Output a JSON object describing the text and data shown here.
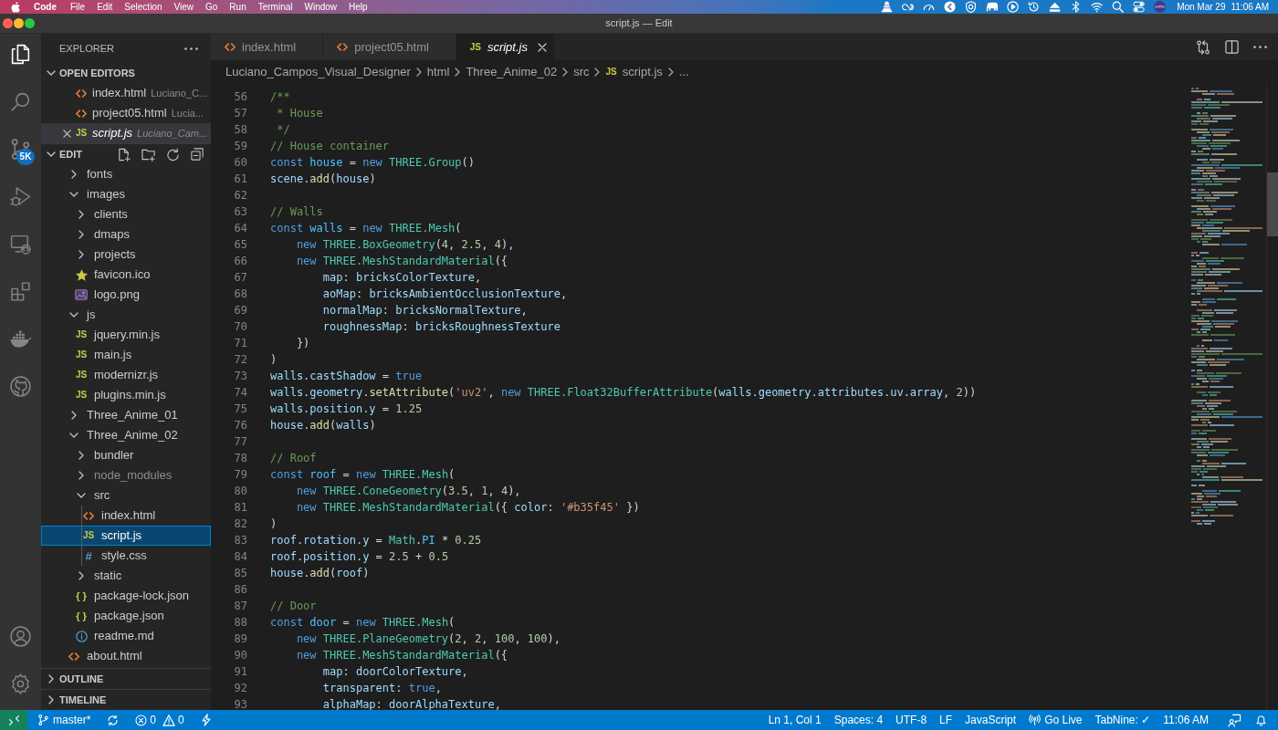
{
  "menu_bar": {
    "app": "Code",
    "menus": [
      "File",
      "Edit",
      "Selection",
      "View",
      "Go",
      "Run",
      "Terminal",
      "Window",
      "Help"
    ],
    "date": "Mon Mar 29",
    "time": "11:06 AM"
  },
  "window": {
    "title": "script.js — Edit"
  },
  "activity_bar": {
    "items": [
      {
        "kind": "explorer",
        "selected": true
      },
      {
        "kind": "search",
        "selected": false
      },
      {
        "kind": "source-control",
        "selected": false,
        "badge": "5K"
      },
      {
        "kind": "run",
        "selected": false
      },
      {
        "kind": "remote",
        "selected": false
      },
      {
        "kind": "extensions",
        "selected": false
      },
      {
        "kind": "docker",
        "selected": false
      },
      {
        "kind": "github",
        "selected": false
      }
    ],
    "bottom": [
      {
        "kind": "accounts"
      },
      {
        "kind": "manage"
      }
    ]
  },
  "sidebar": {
    "title": "EXPLORER",
    "sections": [
      {
        "title": "OPEN EDITORS",
        "kind": "editors",
        "expanded": true,
        "items": [
          {
            "label": "index.html",
            "kind": "html",
            "description": "Luciano_C...",
            "selected": false,
            "preview": false
          },
          {
            "label": "project05.html",
            "kind": "html",
            "description": "Lucia...",
            "selected": false,
            "preview": false
          },
          {
            "label": "script.js",
            "kind": "js",
            "glyph": "JS",
            "description": "Luciano_Cam...",
            "selected": true,
            "preview": true
          }
        ]
      },
      {
        "title": "EDIT",
        "kind": "tree",
        "expanded": true,
        "items": [
          {
            "label": "fonts",
            "kind": "folder",
            "expanded": false,
            "selected": false,
            "dimmed": false
          },
          {
            "label": "images",
            "kind": "folder",
            "expanded": true,
            "selected": false,
            "dimmed": false,
            "children": [
              {
                "label": "clients",
                "kind": "folder",
                "expanded": false,
                "selected": false,
                "dimmed": false
              },
              {
                "label": "dmaps",
                "kind": "folder",
                "expanded": false,
                "selected": false,
                "dimmed": false
              },
              {
                "label": "projects",
                "kind": "folder",
                "expanded": false,
                "selected": false,
                "dimmed": false
              },
              {
                "label": "favicon.ico",
                "kind": "favicon",
                "selected": false,
                "dimmed": false
              },
              {
                "label": "logo.png",
                "kind": "image",
                "selected": false,
                "dimmed": false
              }
            ]
          },
          {
            "label": "js",
            "kind": "folder",
            "expanded": true,
            "selected": false,
            "dimmed": false,
            "children": [
              {
                "label": "jquery.min.js",
                "kind": "js",
                "glyph": "JS",
                "selected": false,
                "dimmed": false
              },
              {
                "label": "main.js",
                "kind": "js",
                "glyph": "JS",
                "selected": false,
                "dimmed": false
              },
              {
                "label": "modernizr.js",
                "kind": "js",
                "glyph": "JS",
                "selected": false,
                "dimmed": false
              },
              {
                "label": "plugins.min.js",
                "kind": "js",
                "glyph": "JS",
                "selected": false,
                "dimmed": false
              }
            ]
          },
          {
            "label": "Three_Anime_01",
            "kind": "folder",
            "expanded": false,
            "selected": false,
            "dimmed": false
          },
          {
            "label": "Three_Anime_02",
            "kind": "folder",
            "expanded": true,
            "selected": false,
            "dimmed": false,
            "children": [
              {
                "label": "bundler",
                "kind": "folder",
                "expanded": false,
                "selected": false,
                "dimmed": false
              },
              {
                "label": "node_modules",
                "kind": "folder",
                "expanded": false,
                "selected": false,
                "dimmed": true
              },
              {
                "label": "src",
                "kind": "folder",
                "expanded": true,
                "selected": false,
                "dimmed": false,
                "children": [
                  {
                    "label": "index.html",
                    "kind": "html",
                    "selected": false,
                    "dimmed": false
                  },
                  {
                    "label": "script.js",
                    "kind": "js",
                    "glyph": "JS",
                    "selected": true,
                    "dimmed": false
                  },
                  {
                    "label": "style.css",
                    "kind": "css",
                    "glyph": "#",
                    "selected": false,
                    "dimmed": false
                  }
                ]
              },
              {
                "label": "static",
                "kind": "folder",
                "expanded": false,
                "selected": false,
                "dimmed": false
              },
              {
                "label": "package-lock.json",
                "kind": "json",
                "glyph": "{ }",
                "selected": false,
                "dimmed": false
              },
              {
                "label": "package.json",
                "kind": "json",
                "glyph": "{ }",
                "selected": false,
                "dimmed": false
              },
              {
                "label": "readme.md",
                "kind": "info",
                "selected": false,
                "dimmed": false
              }
            ]
          },
          {
            "label": "about.html",
            "kind": "html",
            "selected": false,
            "dimmed": false
          }
        ]
      },
      {
        "title": "OUTLINE",
        "kind": "panel",
        "expanded": false
      },
      {
        "title": "TIMELINE",
        "kind": "panel",
        "expanded": false
      }
    ]
  },
  "tabs": [
    {
      "label": "index.html",
      "kind": "html",
      "selected": false,
      "preview": false
    },
    {
      "label": "project05.html",
      "kind": "html",
      "selected": false,
      "preview": false
    },
    {
      "label": "script.js",
      "kind": "js",
      "glyph": "JS",
      "selected": true,
      "preview": true
    }
  ],
  "breadcrumb": [
    {
      "label": "Luciano_Campos_Visual_Designer",
      "kind": "folder"
    },
    {
      "label": "html",
      "kind": "folder"
    },
    {
      "label": "Three_Anime_02",
      "kind": "folder"
    },
    {
      "label": "src",
      "kind": "folder"
    },
    {
      "label": "script.js",
      "kind": "js",
      "glyph": "JS"
    },
    {
      "label": "...",
      "kind": "symbol"
    }
  ],
  "editor": {
    "lines": [
      {
        "number": "56",
        "tokens": [
          {
            "text": "/**",
            "kind": "comment"
          }
        ]
      },
      {
        "number": "57",
        "tokens": [
          {
            "text": " * House",
            "kind": "comment"
          }
        ]
      },
      {
        "number": "58",
        "tokens": [
          {
            "text": " */",
            "kind": "comment"
          }
        ]
      },
      {
        "number": "59",
        "tokens": [
          {
            "text": "// House container",
            "kind": "comment"
          }
        ]
      },
      {
        "number": "60",
        "tokens": [
          {
            "text": "const ",
            "kind": "keyword"
          },
          {
            "text": "house",
            "kind": "constant"
          },
          {
            "text": " = ",
            "kind": "plain"
          },
          {
            "text": "new ",
            "kind": "keyword"
          },
          {
            "text": "THREE.Group",
            "kind": "type"
          },
          {
            "text": "()",
            "kind": "plain"
          }
        ]
      },
      {
        "number": "61",
        "tokens": [
          {
            "text": "scene",
            "kind": "variable"
          },
          {
            "text": ".",
            "kind": "plain"
          },
          {
            "text": "add",
            "kind": "function"
          },
          {
            "text": "(",
            "kind": "plain"
          },
          {
            "text": "house",
            "kind": "variable"
          },
          {
            "text": ")",
            "kind": "plain"
          }
        ]
      },
      {
        "number": "62"
      },
      {
        "number": "63",
        "tokens": [
          {
            "text": "// Walls",
            "kind": "comment"
          }
        ]
      },
      {
        "number": "64",
        "tokens": [
          {
            "text": "const ",
            "kind": "keyword"
          },
          {
            "text": "walls",
            "kind": "constant"
          },
          {
            "text": " = ",
            "kind": "plain"
          },
          {
            "text": "new ",
            "kind": "keyword"
          },
          {
            "text": "THREE.Mesh",
            "kind": "type"
          },
          {
            "text": "(",
            "kind": "plain"
          }
        ]
      },
      {
        "number": "65",
        "tokens": [
          {
            "text": "    new ",
            "kind": "keyword"
          },
          {
            "text": "THREE.BoxGeometry",
            "kind": "type"
          },
          {
            "text": "(",
            "kind": "plain"
          },
          {
            "text": "4",
            "kind": "number"
          },
          {
            "text": ", ",
            "kind": "plain"
          },
          {
            "text": "2.5",
            "kind": "number"
          },
          {
            "text": ", ",
            "kind": "plain"
          },
          {
            "text": "4",
            "kind": "number"
          },
          {
            "text": "),",
            "kind": "plain"
          }
        ]
      },
      {
        "number": "66",
        "tokens": [
          {
            "text": "    new ",
            "kind": "keyword"
          },
          {
            "text": "THREE.MeshStandardMaterial",
            "kind": "type"
          },
          {
            "text": "({",
            "kind": "plain"
          }
        ]
      },
      {
        "number": "67",
        "tokens": [
          {
            "text": "        map",
            "kind": "variable"
          },
          {
            "text": ": ",
            "kind": "plain"
          },
          {
            "text": "bricksColorTexture",
            "kind": "variable"
          },
          {
            "text": ",",
            "kind": "plain"
          }
        ]
      },
      {
        "number": "68",
        "tokens": [
          {
            "text": "        aoMap",
            "kind": "variable"
          },
          {
            "text": ": ",
            "kind": "plain"
          },
          {
            "text": "bricksAmbientOcclusionTexture",
            "kind": "variable"
          },
          {
            "text": ",",
            "kind": "plain"
          }
        ]
      },
      {
        "number": "69",
        "tokens": [
          {
            "text": "        normalMap",
            "kind": "variable"
          },
          {
            "text": ": ",
            "kind": "plain"
          },
          {
            "text": "bricksNormalTexture",
            "kind": "variable"
          },
          {
            "text": ",",
            "kind": "plain"
          }
        ]
      },
      {
        "number": "70",
        "tokens": [
          {
            "text": "        roughnessMap",
            "kind": "variable"
          },
          {
            "text": ": ",
            "kind": "plain"
          },
          {
            "text": "bricksRoughnessTexture",
            "kind": "variable"
          }
        ]
      },
      {
        "number": "71",
        "tokens": [
          {
            "text": "    })",
            "kind": "plain"
          }
        ]
      },
      {
        "number": "72",
        "tokens": [
          {
            "text": ")",
            "kind": "plain"
          }
        ]
      },
      {
        "number": "73",
        "tokens": [
          {
            "text": "walls.castShadow",
            "kind": "variable"
          },
          {
            "text": " = ",
            "kind": "plain"
          },
          {
            "text": "true",
            "kind": "keyword"
          }
        ]
      },
      {
        "number": "74",
        "tokens": [
          {
            "text": "walls.geometry",
            "kind": "variable"
          },
          {
            "text": ".",
            "kind": "plain"
          },
          {
            "text": "setAttribute",
            "kind": "function"
          },
          {
            "text": "(",
            "kind": "plain"
          },
          {
            "text": "'uv2'",
            "kind": "string"
          },
          {
            "text": ", ",
            "kind": "plain"
          },
          {
            "text": "new ",
            "kind": "keyword"
          },
          {
            "text": "THREE.Float32BufferAttribute",
            "kind": "type"
          },
          {
            "text": "(",
            "kind": "plain"
          },
          {
            "text": "walls.geometry.attributes.uv.array",
            "kind": "variable"
          },
          {
            "text": ", ",
            "kind": "plain"
          },
          {
            "text": "2",
            "kind": "number"
          },
          {
            "text": "))",
            "kind": "plain"
          }
        ]
      },
      {
        "number": "75",
        "tokens": [
          {
            "text": "walls.position.y",
            "kind": "variable"
          },
          {
            "text": " = ",
            "kind": "plain"
          },
          {
            "text": "1.25",
            "kind": "number"
          }
        ]
      },
      {
        "number": "76",
        "tokens": [
          {
            "text": "house",
            "kind": "variable"
          },
          {
            "text": ".",
            "kind": "plain"
          },
          {
            "text": "add",
            "kind": "function"
          },
          {
            "text": "(",
            "kind": "plain"
          },
          {
            "text": "walls",
            "kind": "variable"
          },
          {
            "text": ")",
            "kind": "plain"
          }
        ]
      },
      {
        "number": "77"
      },
      {
        "number": "78",
        "tokens": [
          {
            "text": "// Roof",
            "kind": "comment"
          }
        ]
      },
      {
        "number": "79",
        "tokens": [
          {
            "text": "const ",
            "kind": "keyword"
          },
          {
            "text": "roof",
            "kind": "constant"
          },
          {
            "text": " = ",
            "kind": "plain"
          },
          {
            "text": "new ",
            "kind": "keyword"
          },
          {
            "text": "THREE.Mesh",
            "kind": "type"
          },
          {
            "text": "(",
            "kind": "plain"
          }
        ]
      },
      {
        "number": "80",
        "tokens": [
          {
            "text": "    new ",
            "kind": "keyword"
          },
          {
            "text": "THREE.ConeGeometry",
            "kind": "type"
          },
          {
            "text": "(",
            "kind": "plain"
          },
          {
            "text": "3.5",
            "kind": "number"
          },
          {
            "text": ", ",
            "kind": "plain"
          },
          {
            "text": "1",
            "kind": "number"
          },
          {
            "text": ", ",
            "kind": "plain"
          },
          {
            "text": "4",
            "kind": "number"
          },
          {
            "text": "),",
            "kind": "plain"
          }
        ]
      },
      {
        "number": "81",
        "tokens": [
          {
            "text": "    new ",
            "kind": "keyword"
          },
          {
            "text": "THREE.MeshStandardMaterial",
            "kind": "type"
          },
          {
            "text": "({ ",
            "kind": "plain"
          },
          {
            "text": "color",
            "kind": "variable"
          },
          {
            "text": ": ",
            "kind": "plain"
          },
          {
            "text": "'#b35f45'",
            "kind": "string"
          },
          {
            "text": " })",
            "kind": "plain"
          }
        ]
      },
      {
        "number": "82",
        "tokens": [
          {
            "text": ")",
            "kind": "plain"
          }
        ]
      },
      {
        "number": "83",
        "tokens": [
          {
            "text": "roof.rotation.y",
            "kind": "variable"
          },
          {
            "text": " = ",
            "kind": "plain"
          },
          {
            "text": "Math",
            "kind": "type"
          },
          {
            "text": ".",
            "kind": "plain"
          },
          {
            "text": "PI",
            "kind": "constant"
          },
          {
            "text": " * ",
            "kind": "plain"
          },
          {
            "text": "0.25",
            "kind": "number"
          }
        ]
      },
      {
        "number": "84",
        "tokens": [
          {
            "text": "roof.position.y",
            "kind": "variable"
          },
          {
            "text": " = ",
            "kind": "plain"
          },
          {
            "text": "2.5",
            "kind": "number"
          },
          {
            "text": " + ",
            "kind": "plain"
          },
          {
            "text": "0.5",
            "kind": "number"
          }
        ]
      },
      {
        "number": "85",
        "tokens": [
          {
            "text": "house",
            "kind": "variable"
          },
          {
            "text": ".",
            "kind": "plain"
          },
          {
            "text": "add",
            "kind": "function"
          },
          {
            "text": "(",
            "kind": "plain"
          },
          {
            "text": "roof",
            "kind": "variable"
          },
          {
            "text": ")",
            "kind": "plain"
          }
        ]
      },
      {
        "number": "86"
      },
      {
        "number": "87",
        "tokens": [
          {
            "text": "// Door",
            "kind": "comment"
          }
        ]
      },
      {
        "number": "88",
        "tokens": [
          {
            "text": "const ",
            "kind": "keyword"
          },
          {
            "text": "door",
            "kind": "constant"
          },
          {
            "text": " = ",
            "kind": "plain"
          },
          {
            "text": "new ",
            "kind": "keyword"
          },
          {
            "text": "THREE.Mesh",
            "kind": "type"
          },
          {
            "text": "(",
            "kind": "plain"
          }
        ]
      },
      {
        "number": "89",
        "tokens": [
          {
            "text": "    new ",
            "kind": "keyword"
          },
          {
            "text": "THREE.PlaneGeometry",
            "kind": "type"
          },
          {
            "text": "(",
            "kind": "plain"
          },
          {
            "text": "2",
            "kind": "number"
          },
          {
            "text": ", ",
            "kind": "plain"
          },
          {
            "text": "2",
            "kind": "number"
          },
          {
            "text": ", ",
            "kind": "plain"
          },
          {
            "text": "100",
            "kind": "number"
          },
          {
            "text": ", ",
            "kind": "plain"
          },
          {
            "text": "100",
            "kind": "number"
          },
          {
            "text": "),",
            "kind": "plain"
          }
        ]
      },
      {
        "number": "90",
        "tokens": [
          {
            "text": "    new ",
            "kind": "keyword"
          },
          {
            "text": "THREE.MeshStandardMaterial",
            "kind": "type"
          },
          {
            "text": "({",
            "kind": "plain"
          }
        ]
      },
      {
        "number": "91",
        "tokens": [
          {
            "text": "        map",
            "kind": "variable"
          },
          {
            "text": ": ",
            "kind": "plain"
          },
          {
            "text": "doorColorTexture",
            "kind": "variable"
          },
          {
            "text": ",",
            "kind": "plain"
          }
        ]
      },
      {
        "number": "92",
        "tokens": [
          {
            "text": "        transparent",
            "kind": "variable"
          },
          {
            "text": ": ",
            "kind": "plain"
          },
          {
            "text": "true",
            "kind": "keyword"
          },
          {
            "text": ",",
            "kind": "plain"
          }
        ]
      },
      {
        "number": "93",
        "tokens": [
          {
            "text": "        alphaMap",
            "kind": "variable"
          },
          {
            "text": ": ",
            "kind": "plain"
          },
          {
            "text": "doorAlphaTexture",
            "kind": "variable"
          },
          {
            "text": ",",
            "kind": "plain"
          }
        ]
      }
    ]
  },
  "status_bar": {
    "left": [
      {
        "kind": "remote"
      },
      {
        "kind": "branch",
        "text": "master*"
      },
      {
        "kind": "sync"
      },
      {
        "kind": "problems",
        "errors": "0",
        "warnings": "0"
      },
      {
        "kind": "bolt"
      }
    ],
    "right": [
      {
        "kind": "cursor",
        "text": "Ln 1, Col 1"
      },
      {
        "kind": "indent",
        "text": "Spaces: 4"
      },
      {
        "kind": "encoding",
        "text": "UTF-8"
      },
      {
        "kind": "eol",
        "text": "LF"
      },
      {
        "kind": "language",
        "text": "JavaScript"
      },
      {
        "kind": "live",
        "text": "Go Live"
      },
      {
        "kind": "extension",
        "text": "TabNine: ✓"
      },
      {
        "kind": "clock",
        "text": "11:06 AM"
      },
      {
        "kind": "feedback"
      },
      {
        "kind": "notifications"
      }
    ]
  }
}
